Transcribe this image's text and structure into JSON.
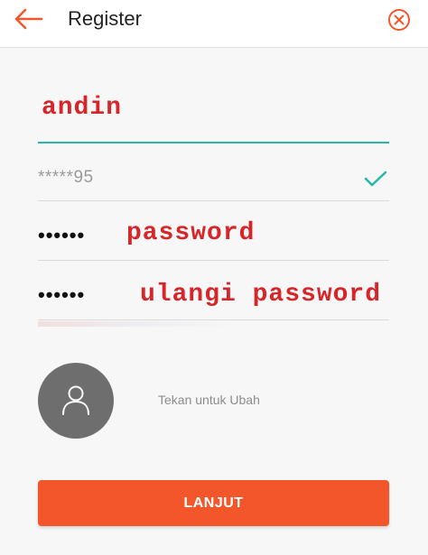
{
  "header": {
    "title": "Register",
    "back_icon": "arrow-left-icon",
    "close_icon": "close-circle-icon",
    "accent_color": "#f4562c"
  },
  "form": {
    "username_annotation": "andin",
    "phone_value": "*****95",
    "phone_verified_icon": "check-icon",
    "password_value": "••••••",
    "password_annotation": "password",
    "confirm_password_value": "••••••",
    "confirm_password_annotation": "ulangi password"
  },
  "avatar": {
    "icon": "user-icon",
    "hint": "Tekan untuk Ubah"
  },
  "actions": {
    "continue_label": "LANJUT",
    "continue_color": "#f4562c"
  }
}
